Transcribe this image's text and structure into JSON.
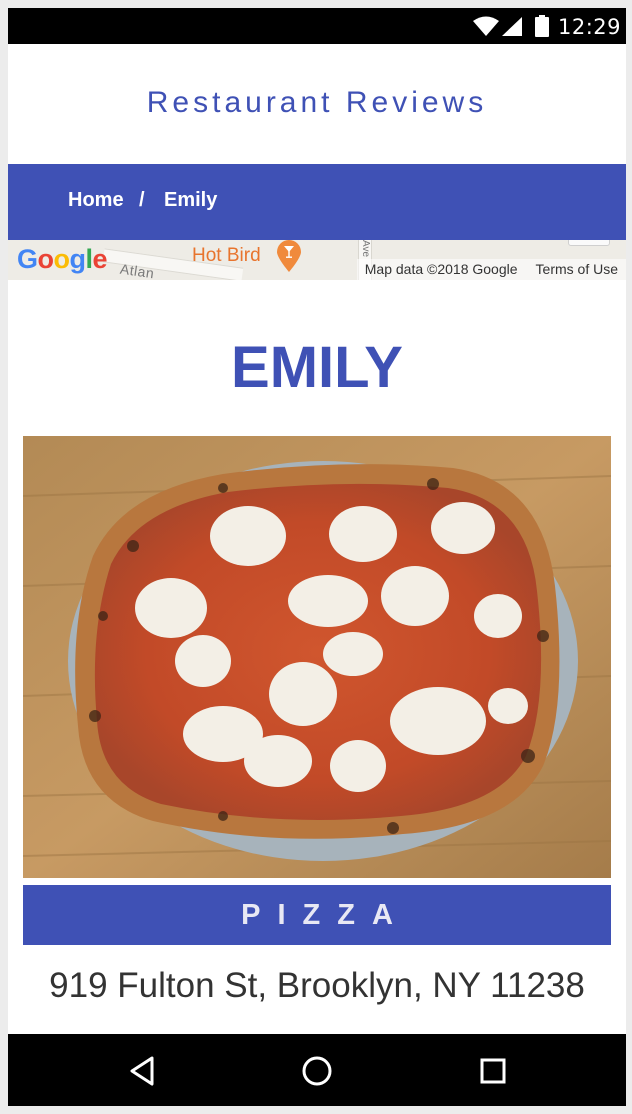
{
  "status_bar": {
    "time": "12:29",
    "icons": [
      "wifi-icon",
      "cell-signal-icon",
      "battery-icon"
    ]
  },
  "header": {
    "title": "Restaurant Reviews"
  },
  "breadcrumb": {
    "home_label": "Home",
    "separator": "/",
    "current_label": "Emily"
  },
  "map": {
    "logo_text": "Google",
    "poi_label": "Hot Bird",
    "street_label": "Atlan",
    "ave_label": "Ave",
    "map_data": "Map data ©2018 Google",
    "terms": "Terms of Use"
  },
  "restaurant": {
    "name": "EMILY",
    "cuisine": "PIZZA",
    "address": "919 Fulton St, Brooklyn, NY 11238",
    "image_subject": "pizza-photo"
  },
  "nav_bar": {
    "icons": [
      "back-icon",
      "home-icon",
      "recents-icon"
    ]
  },
  "colors": {
    "accent": "#3f51b5",
    "status_bar": "#000000",
    "text": "#333333"
  }
}
